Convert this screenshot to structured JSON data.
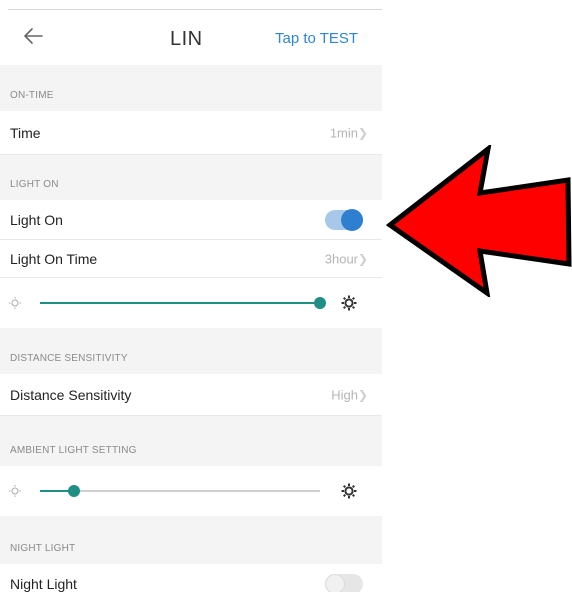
{
  "header": {
    "title": "LIN",
    "action_label": "Tap to TEST"
  },
  "sections": {
    "on_time": "ON-TIME",
    "light_on": "LIGHT ON",
    "distance": "DISTANCE SENSITIVITY",
    "ambient": "AMBIENT LIGHT SETTING",
    "night": "NIGHT LIGHT"
  },
  "rows": {
    "time": {
      "label": "Time",
      "value": "1min"
    },
    "light_on": {
      "label": "Light On",
      "state": "on"
    },
    "light_on_time": {
      "label": "Light On Time",
      "value": "3hour"
    },
    "distance_sensitivity": {
      "label": "Distance Sensitivity",
      "value": "High"
    },
    "night_light": {
      "label": "Night Light",
      "state": "off"
    }
  },
  "sliders": {
    "brightness_level": 1.0,
    "ambient_level": 0.12
  },
  "colors": {
    "accent": "#2f86d4",
    "slider": "#1f8f86",
    "arrow": "#ff0000"
  },
  "icons": {
    "back": "arrow-left",
    "chevron": "chevron-right",
    "brightness_low": "sun-small",
    "brightness_high": "sun-large"
  }
}
